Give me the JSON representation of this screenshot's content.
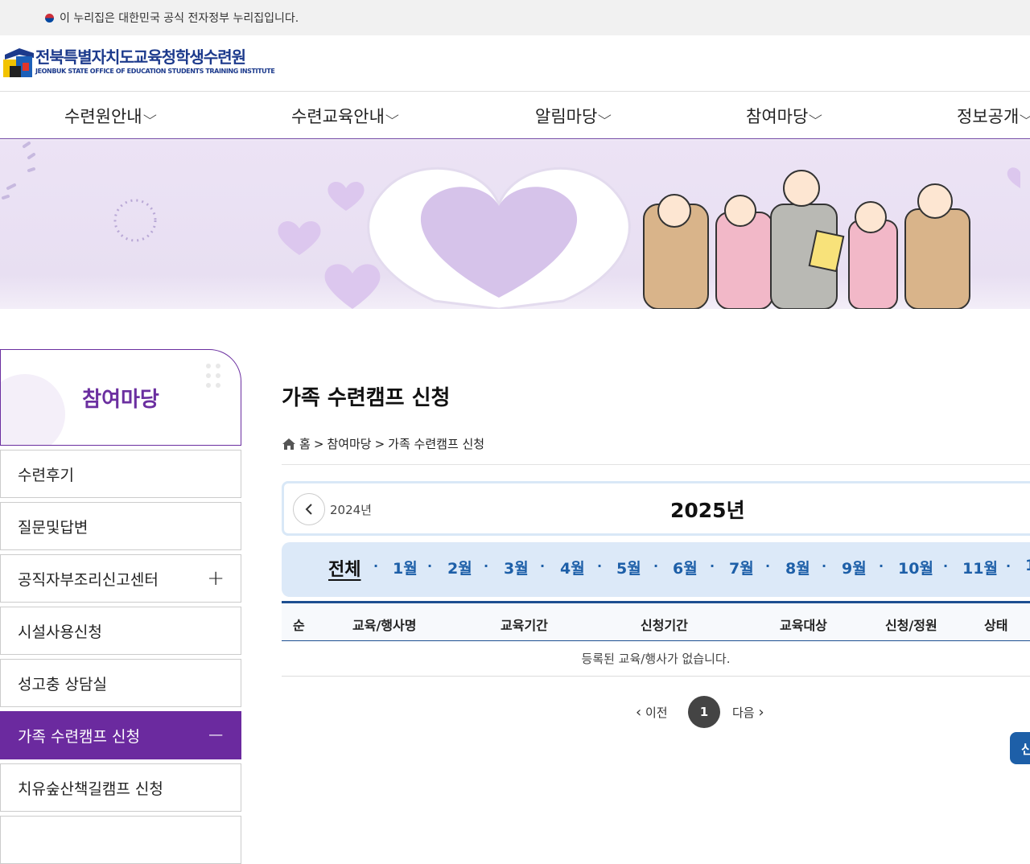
{
  "gov_banner": {
    "text": "이 누리집은 대한민국 공식 전자정부 누리집입니다."
  },
  "logo": {
    "title_kr": "전북특별자치도교육청학생수련원",
    "title_en": "JEONBUK STATE OFFICE OF EDUCATION STUDENTS TRAINING INSTITUTE"
  },
  "gnb": {
    "items": [
      {
        "label": "수련원안내",
        "icon": "chevron-down-icon"
      },
      {
        "label": "수련교육안내",
        "icon": "chevron-down-icon"
      },
      {
        "label": "알림마당",
        "icon": "chevron-down-icon"
      },
      {
        "label": "참여마당",
        "icon": "chevron-down-icon"
      },
      {
        "label": "정보공개",
        "icon": "chevron-down-icon"
      }
    ]
  },
  "lnb": {
    "title": "참여마당",
    "items": [
      {
        "label": "수련후기",
        "sign": ""
      },
      {
        "label": "질문및답변",
        "sign": ""
      },
      {
        "label": "공직자부조리신고센터",
        "sign": "+"
      },
      {
        "label": "시설사용신청",
        "sign": ""
      },
      {
        "label": "성고충 상담실",
        "sign": ""
      },
      {
        "label": "가족 수련캠프 신청",
        "sign": "−"
      },
      {
        "label": "치유숲산책길캠프 신청",
        "sign": ""
      }
    ]
  },
  "page": {
    "title": "가족 수련캠프 신청",
    "breadcrumb": {
      "home": "홈",
      "sep": ">",
      "level1": "참여마당",
      "level2": "가족 수련캠프 신청"
    }
  },
  "year_nav": {
    "prev_year": "2024년",
    "current_year": "2025년"
  },
  "month_tabs": [
    "전체",
    "1월",
    "2월",
    "3월",
    "4월",
    "5월",
    "6월",
    "7월",
    "8월",
    "9월",
    "10월",
    "11월",
    "1"
  ],
  "table": {
    "headers": [
      "순",
      "교육/행사명",
      "교육기간",
      "신청기간",
      "교육대상",
      "신청/정원",
      "상태"
    ],
    "empty_message": "등록된 교육/행사가 없습니다."
  },
  "pagination": {
    "prev": "이전",
    "current": "1",
    "next": "다음"
  },
  "floating": {
    "label": "신"
  },
  "colors": {
    "brand_purple": "#6b2a9f",
    "brand_blue": "#1d4f91",
    "tab_bg": "#dce9f8"
  }
}
